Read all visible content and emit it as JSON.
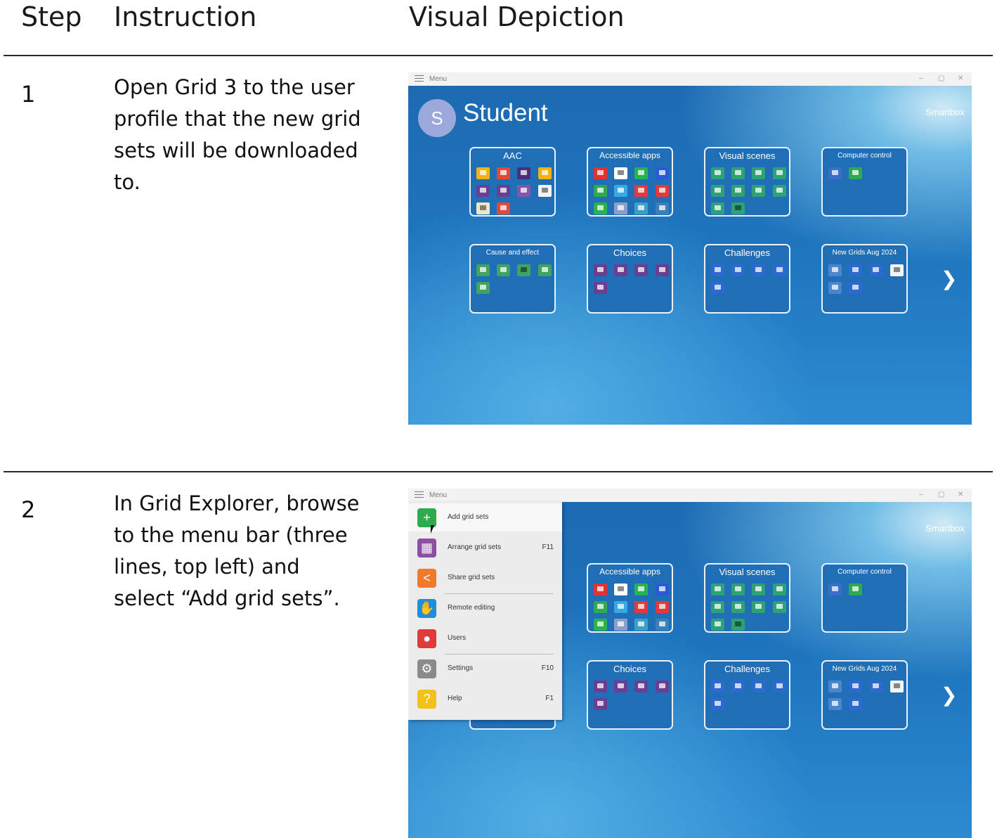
{
  "table": {
    "headers": {
      "step": "Step",
      "instruction": "Instruction",
      "visual": "Visual Depiction"
    },
    "rows": [
      {
        "step": "1",
        "instruction": "Open Grid 3 to the user profile that the new grid sets will be downloaded to."
      },
      {
        "step": "2",
        "instruction": "In Grid Explorer, browse to the menu bar (three lines, top left) and select “Add grid sets”."
      }
    ]
  },
  "app": {
    "menu_label": "Menu",
    "window_controls": {
      "minimize": "–",
      "restore": "▢",
      "close": "✕"
    },
    "brand": "Smartbox",
    "user": {
      "initial": "S",
      "name": "Student"
    },
    "next_icon": "chevron-right-icon",
    "tiles": {
      "aac": "AAC",
      "accessible_apps": "Accessible apps",
      "visual_scenes": "Visual scenes",
      "computer_control": "Computer control",
      "cause_effect": "Cause and effect",
      "choices": "Choices",
      "challenges": "Challenges",
      "new_grids": "New Grids Aug 2024"
    },
    "menu_items": [
      {
        "label": "Add grid sets",
        "key": "",
        "icon": "plus-icon",
        "color": "#2eaa4f"
      },
      {
        "label": "Arrange grid sets",
        "key": "F11",
        "icon": "grid-icon",
        "color": "#8d4fa6"
      },
      {
        "label": "Share grid sets",
        "key": "",
        "icon": "share-icon",
        "color": "#f07a2a"
      },
      {
        "label": "Remote editing",
        "key": "",
        "icon": "hand-icon",
        "color": "#1d8fdc"
      },
      {
        "label": "Users",
        "key": "",
        "icon": "user-icon",
        "color": "#e03a3a"
      },
      {
        "label": "Settings",
        "key": "F10",
        "icon": "gear-icon",
        "color": "#8a8a8a"
      },
      {
        "label": "Help",
        "key": "F1",
        "icon": "question-icon",
        "color": "#f2c21a"
      }
    ]
  }
}
